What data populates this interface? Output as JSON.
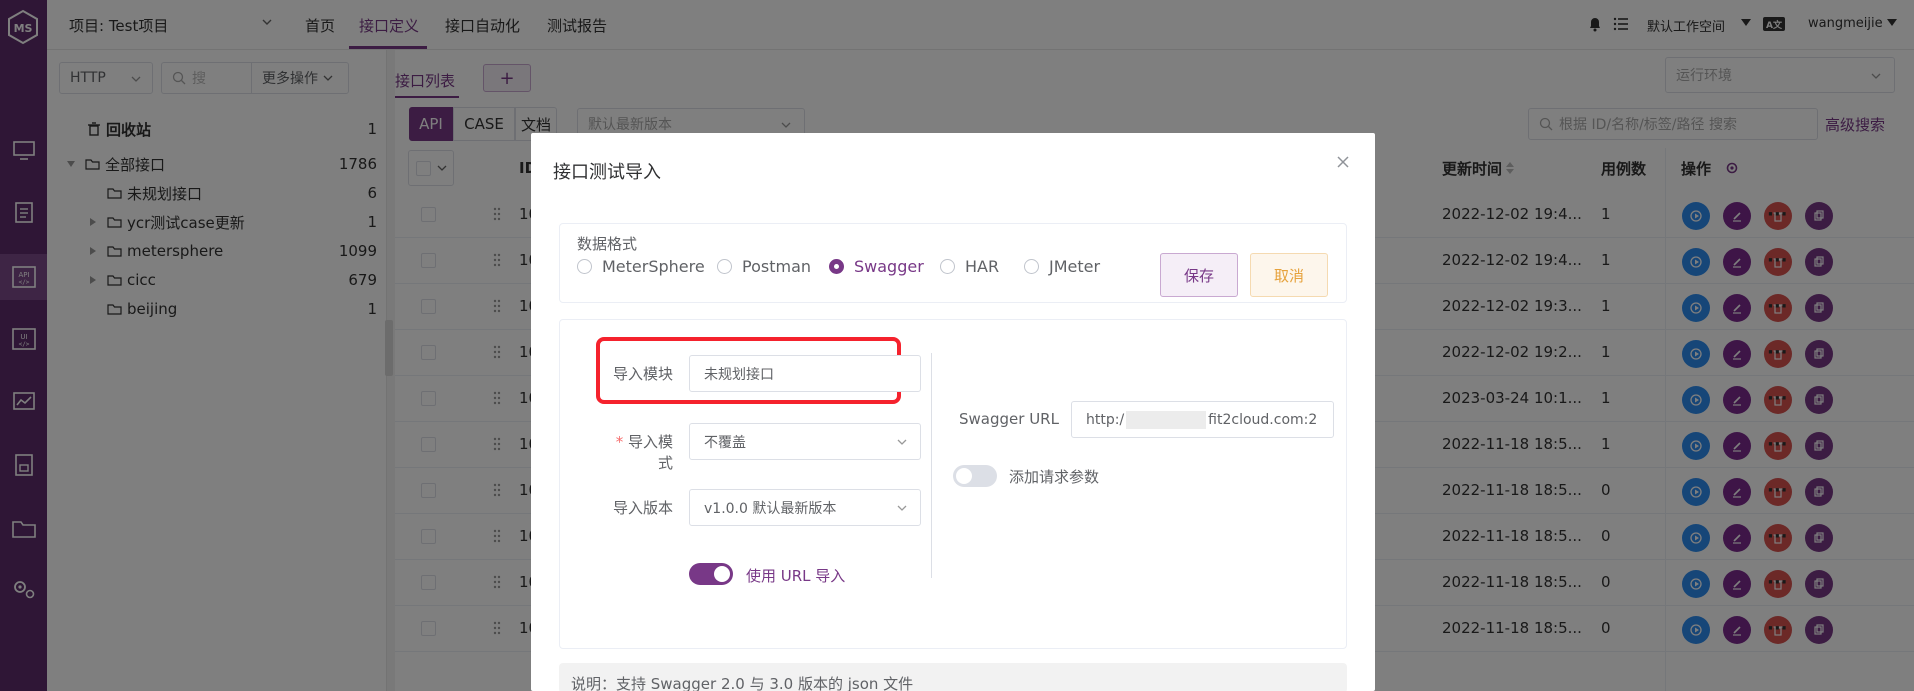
{
  "colors": {
    "brand": "#783887",
    "rail": "#5e2d6c",
    "run": "#2d8cf0",
    "edit": "#7c2b8f",
    "delete": "#d9534f",
    "copy": "#783887",
    "cancel_bg": "#fdf6ec",
    "cancel_text": "#e6a23c",
    "highlight": "#f5222d"
  },
  "topbar": {
    "project": "项目: Test项目",
    "menu": [
      "首页",
      "接口定义",
      "接口自动化",
      "测试报告"
    ],
    "active_menu": "接口定义",
    "workspace": "默认工作空间",
    "user": "wangmeijie"
  },
  "left": {
    "protocol": "HTTP",
    "search_placeholder": "搜",
    "more_ops": "更多操作",
    "recycle": {
      "label": "回收站",
      "count": "1"
    },
    "all": {
      "label": "全部接口",
      "count": "1786"
    },
    "children": [
      {
        "label": "未规划接口",
        "count": "6",
        "expandable": false
      },
      {
        "label": "ycr测试case更新",
        "count": "1",
        "expandable": true
      },
      {
        "label": "metersphere",
        "count": "1099",
        "expandable": true
      },
      {
        "label": "cicc",
        "count": "679",
        "expandable": true
      },
      {
        "label": "beijing",
        "count": "1",
        "expandable": false
      }
    ]
  },
  "main": {
    "tab": "接口列表",
    "add": "+",
    "env_placeholder": "运行环境",
    "view_buttons": [
      "API",
      "CASE",
      "文档"
    ],
    "version_placeholder": "默认最新版本",
    "search_placeholder": "根据 ID/名称/标签/路径 搜索",
    "advanced": "高级搜索",
    "columns": {
      "id": "ID",
      "updated": "更新时间",
      "cases": "用例数",
      "ops": "操作"
    },
    "rows": [
      {
        "id": "10",
        "time": "2022-12-02 19:4...",
        "cases": "1"
      },
      {
        "id": "10",
        "time": "2022-12-02 19:4...",
        "cases": "1"
      },
      {
        "id": "10",
        "time": "2022-12-02 19:3...",
        "cases": "1"
      },
      {
        "id": "10",
        "time": "2022-12-02 19:2...",
        "cases": "1"
      },
      {
        "id": "10",
        "time": "2023-03-24 10:1...",
        "cases": "1"
      },
      {
        "id": "10",
        "time": "2022-11-18 18:5...",
        "cases": "1"
      },
      {
        "id": "10",
        "time": "2022-11-18 18:5...",
        "cases": "0"
      },
      {
        "id": "10",
        "time": "2022-11-18 18:5...",
        "cases": "0"
      },
      {
        "id": "10",
        "time": "2022-11-18 18:5...",
        "cases": "0"
      },
      {
        "id": "10",
        "time": "2022-11-18 18:5...",
        "cases": "0"
      }
    ]
  },
  "dialog": {
    "title": "接口测试导入",
    "format_label": "数据格式",
    "formats": [
      "MeterSphere",
      "Postman",
      "Swagger",
      "HAR",
      "JMeter"
    ],
    "selected_format": "Swagger",
    "save": "保存",
    "cancel": "取消",
    "module_label": "导入模块",
    "module_value": "未规划接口",
    "mode_label": "导入模式",
    "mode_value": "不覆盖",
    "version_label": "导入版本",
    "version_value": "v1.0.0 默认最新版本",
    "url_import_label": "使用 URL 导入",
    "url_import_on": true,
    "swagger_url_label": "Swagger URL",
    "swagger_url_prefix": "http:/",
    "swagger_url_suffix": "fit2cloud.com:2",
    "add_params_label": "添加请求参数",
    "add_params_on": false,
    "note": "说明：支持 Swagger 2.0 与 3.0 版本的 json 文件"
  }
}
